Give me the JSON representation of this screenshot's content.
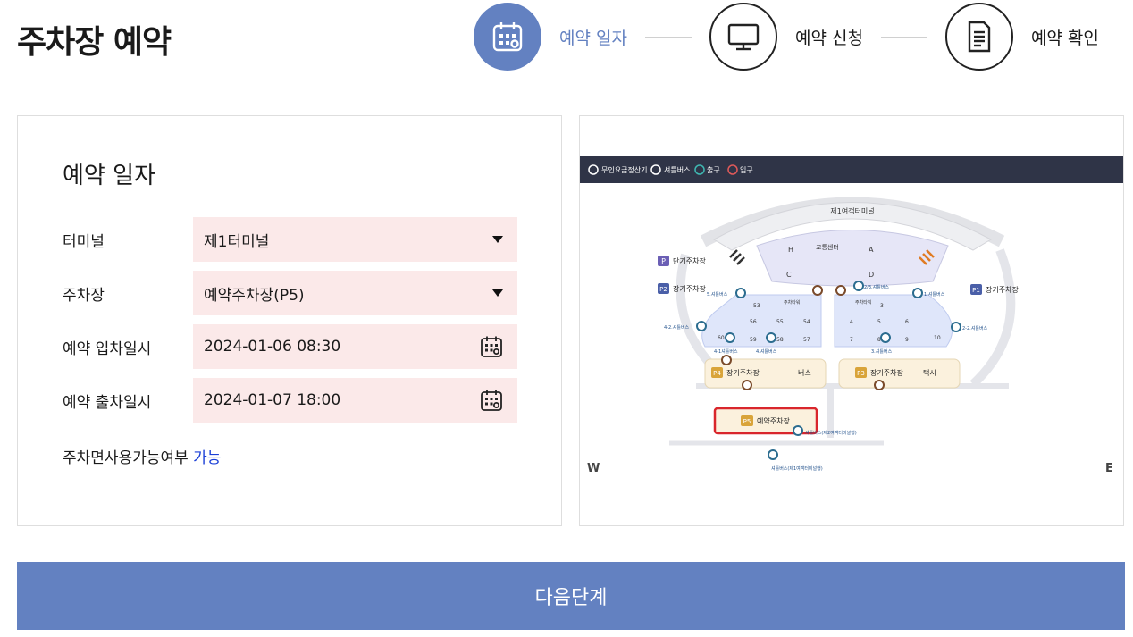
{
  "header": {
    "title": "주차장 예약"
  },
  "steps": [
    {
      "label": "예약 일자",
      "icon": "calendar-icon",
      "active": true
    },
    {
      "label": "예약 신청",
      "icon": "monitor-icon",
      "active": false
    },
    {
      "label": "예약 확인",
      "icon": "document-icon",
      "active": false
    }
  ],
  "form": {
    "title": "예약 일자",
    "terminal": {
      "label": "터미널",
      "value": "제1터미널"
    },
    "parking": {
      "label": "주차장",
      "value": "예약주차장(P5)"
    },
    "entry": {
      "label": "예약 입차일시",
      "value": "2024-01-06 08:30"
    },
    "exit": {
      "label": "예약 출차일시",
      "value": "2024-01-07 18:00"
    },
    "availability": {
      "label": "주차면사용가능여부",
      "value": "가능"
    }
  },
  "map": {
    "legend": [
      "무인요금정산기",
      "셔틀버스",
      "출구",
      "입구"
    ],
    "terminal_label": "제1여객터미널",
    "center_label": "교통센터",
    "zones": [
      "H",
      "A",
      "C",
      "D"
    ],
    "short_term": "단기주차장",
    "long_term": "장기주차장",
    "lots": [
      "P",
      "P2",
      "P1",
      "P4",
      "P3",
      "P5"
    ],
    "bus": "버스",
    "taxi": "택시",
    "reserved": "예약주차장",
    "tower": "주차타워",
    "blocks": [
      "53",
      "56",
      "55",
      "54",
      "59",
      "58",
      "57",
      "60",
      "3",
      "4",
      "5",
      "6",
      "7",
      "8",
      "9",
      "10"
    ],
    "shuttle_labels": [
      "5.셔틀버스",
      "2/3.셔틀버스",
      "1.셔틀버스",
      "4-2.셔틀버스",
      "2-2.셔틀버스",
      "4-1셔틀버스",
      "4.셔틀버스",
      "3.셔틀버스",
      "셔틀버스(제2여객터미널행)",
      "셔틀버스(제1여객터미널행)"
    ],
    "west": "W",
    "east": "E",
    "colors": {
      "legend_bar": "#2f3447",
      "lot_badge": "#6b5fb5",
      "long_lot": "#d9a43a",
      "reserved_border": "#d9262c",
      "block_fill": "#dfe6fa"
    }
  },
  "actions": {
    "next_label": "다음단계"
  }
}
